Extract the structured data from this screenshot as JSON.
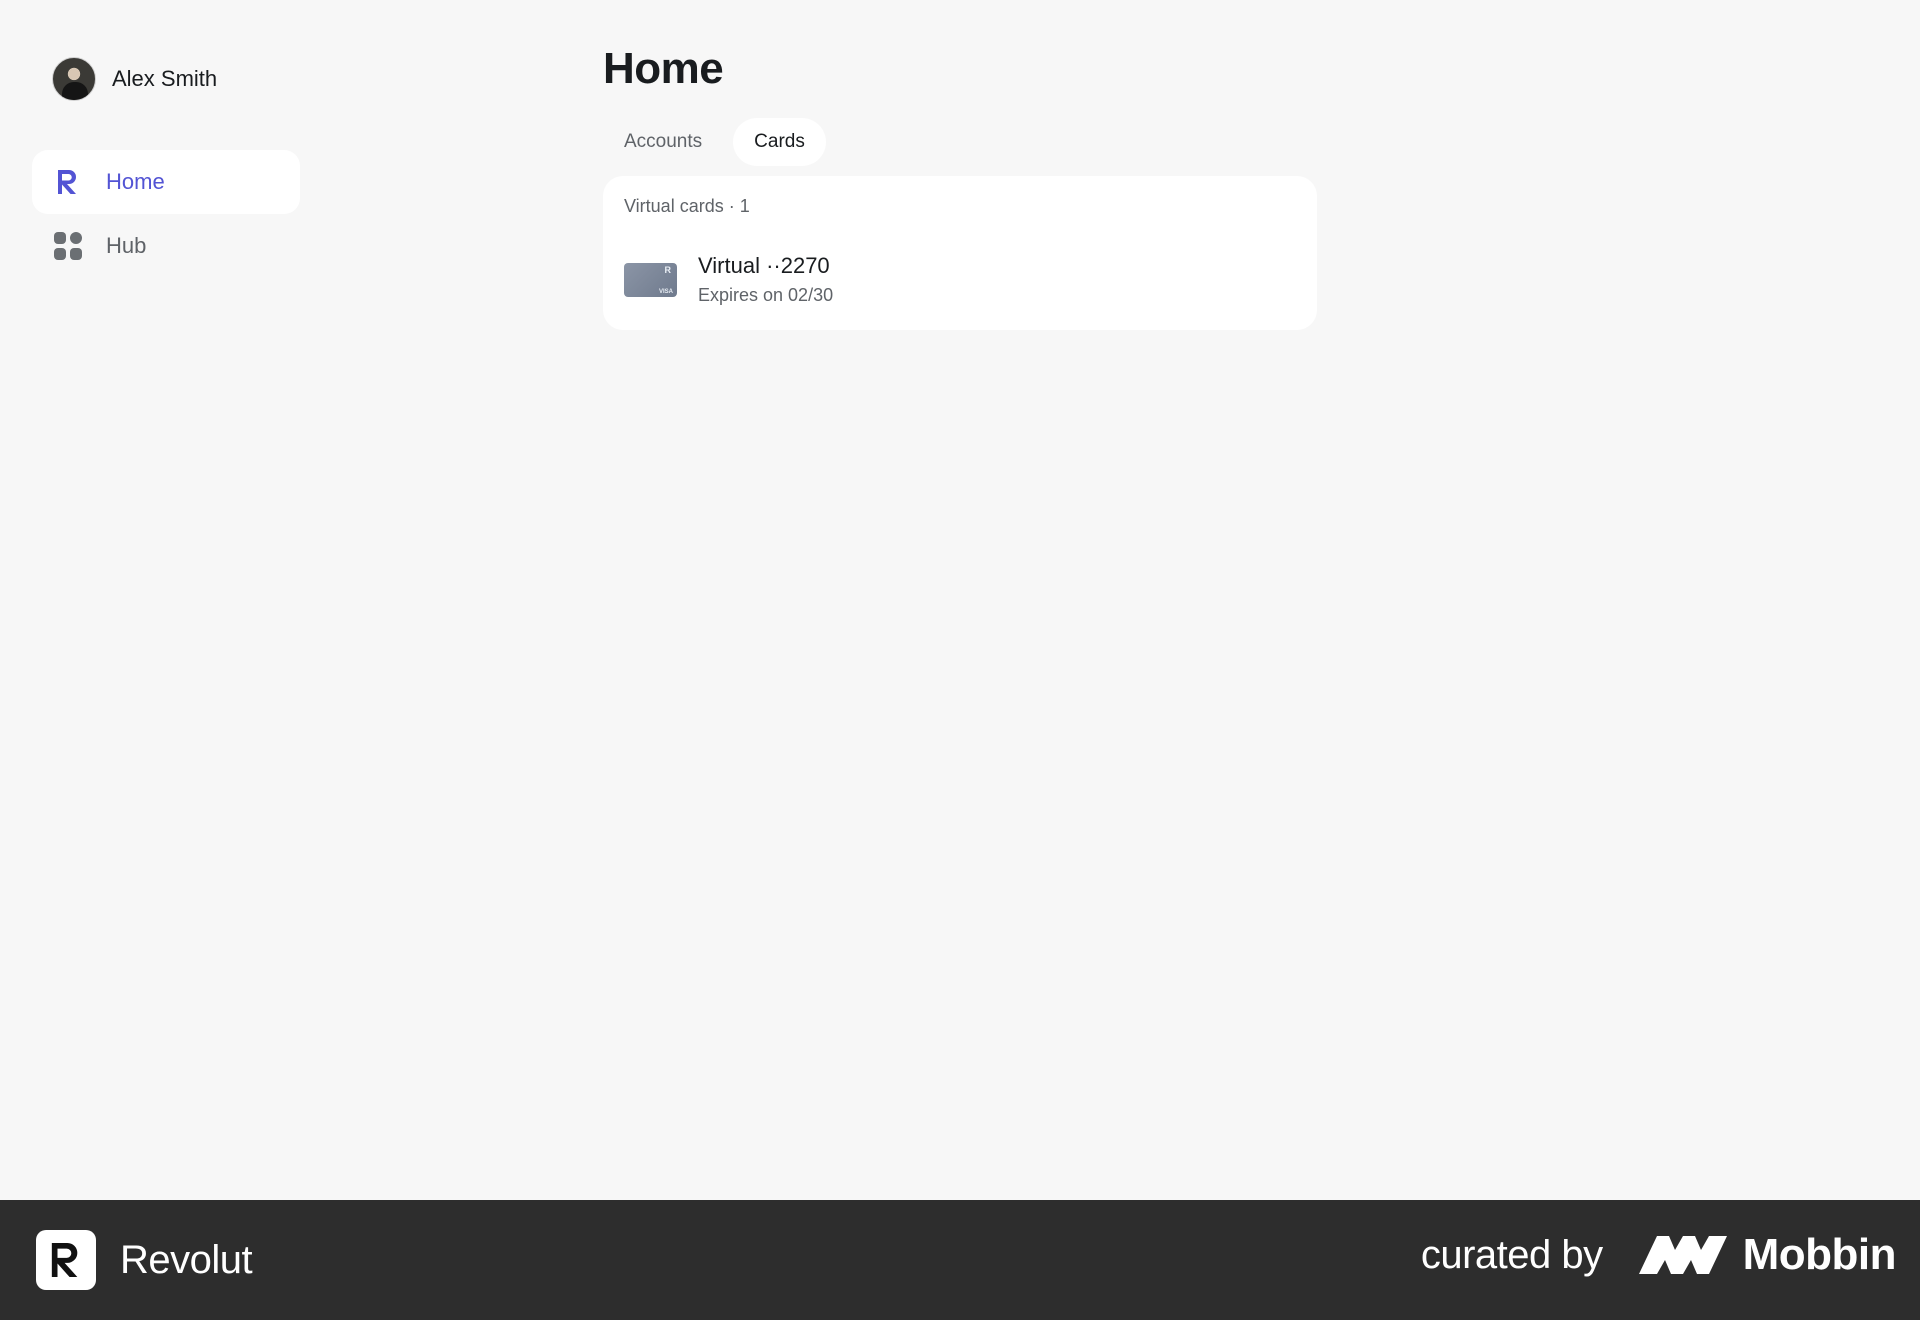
{
  "sidebar": {
    "user": {
      "name": "Alex Smith",
      "avatar_icon": "user-avatar"
    },
    "items": [
      {
        "label": "Home",
        "icon": "revolut-r-icon",
        "active": true
      },
      {
        "label": "Hub",
        "icon": "grid-icon",
        "active": false
      }
    ]
  },
  "main": {
    "title": "Home",
    "tabs": [
      {
        "label": "Accounts",
        "active": false
      },
      {
        "label": "Cards",
        "active": true
      }
    ],
    "virtual_cards": {
      "header": "Virtual cards · 1",
      "items": [
        {
          "name": "Virtual ··2270",
          "expiry": "Expires on 02/30",
          "thumb_brand": "R",
          "thumb_network": "VISA"
        }
      ]
    }
  },
  "footer": {
    "brand_name": "Revolut",
    "curated_label": "curated by",
    "curator_name": "Mobbin"
  },
  "colors": {
    "accent": "#5354d4",
    "background": "#f7f7f7",
    "footer_bg": "#2d2d2d"
  }
}
